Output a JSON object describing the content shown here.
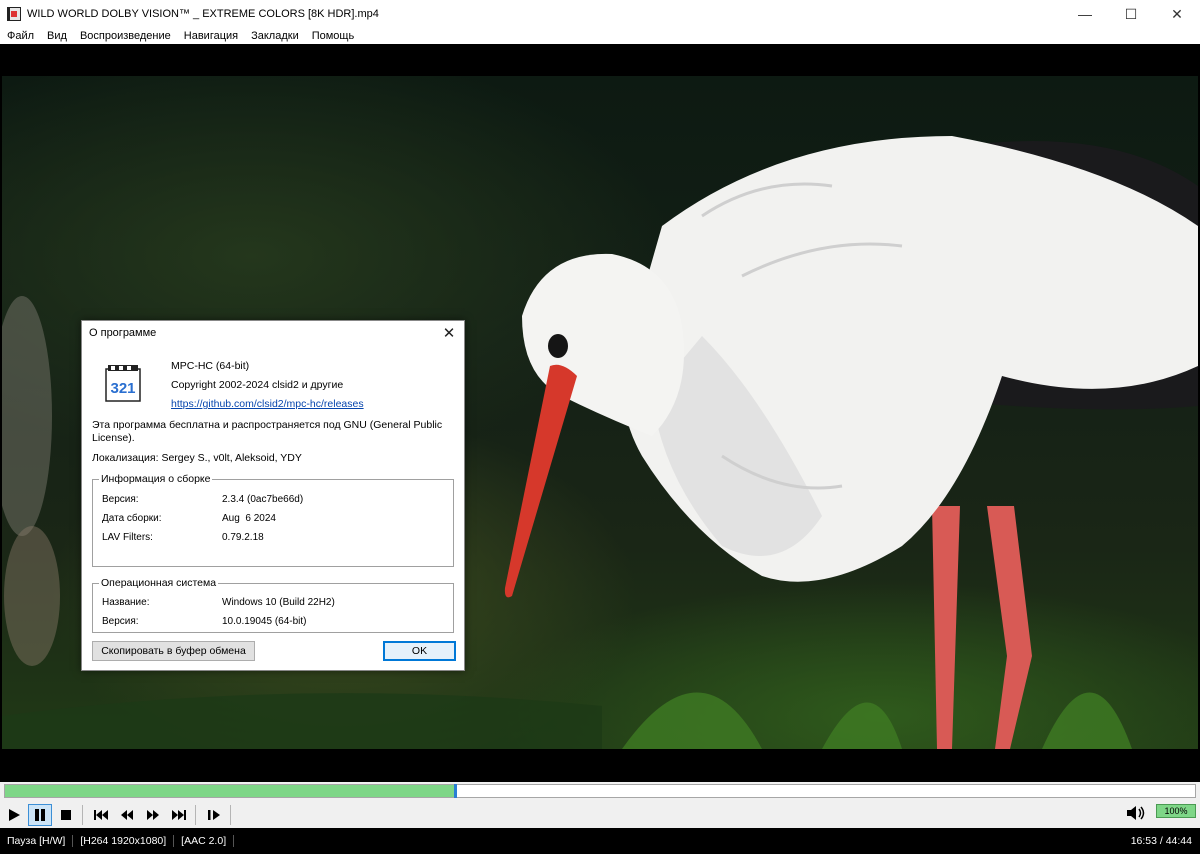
{
  "window": {
    "title": "WILD WORLD DOLBY VISION™ _ EXTREME COLORS [8K HDR].mp4",
    "minimize_glyph": "—",
    "maximize_glyph": "☐",
    "close_glyph": "✕"
  },
  "menu": [
    "Файл",
    "Вид",
    "Воспроизведение",
    "Навигация",
    "Закладки",
    "Помощь"
  ],
  "about_dialog": {
    "title": "О программе",
    "close_glyph": "✕",
    "logo_text": "321",
    "app_name": "MPC-HC (64-bit)",
    "copyright": "Copyright 2002-2024 clsid2 и другие",
    "link": "https://github.com/clsid2/mpc-hc/releases",
    "license_line1": "Эта программа бесплатна и распространяется под GNU (General Public",
    "license_line2": "License).",
    "localization": "Локализация: Sergey S., v0lt, Aleksoid, YDY",
    "build_group": {
      "legend": "Информация о сборке",
      "rows": [
        {
          "label": "Версия:",
          "value": "2.3.4 (0ac7be66d)"
        },
        {
          "label": "Дата сборки:",
          "value": "Aug  6 2024"
        },
        {
          "label": "LAV Filters:",
          "value": "0.79.2.18"
        }
      ]
    },
    "os_group": {
      "legend": "Операционная система",
      "rows": [
        {
          "label": "Название:",
          "value": "Windows 10 (Build 22H2)"
        },
        {
          "label": "Версия:",
          "value": "10.0.19045 (64-bit)"
        }
      ]
    },
    "copy_button": "Скопировать в буфер обмена",
    "ok_button": "OK"
  },
  "seek": {
    "progress_fraction": 0.378
  },
  "volume": {
    "label": "100%",
    "fraction": 1.0
  },
  "status": {
    "state": "Пауза [H/W]",
    "video": "[H264 1920x1080]",
    "audio": "[AAC 2.0]",
    "time": "16:53 / 44:44"
  },
  "icons": {
    "play": "play-icon",
    "pause": "pause-icon",
    "stop": "stop-icon",
    "prev": "skip-back-icon",
    "rewind": "rewind-icon",
    "forward": "fast-forward-icon",
    "next": "skip-forward-icon",
    "frame_step": "frame-step-icon",
    "volume": "speaker-icon"
  }
}
